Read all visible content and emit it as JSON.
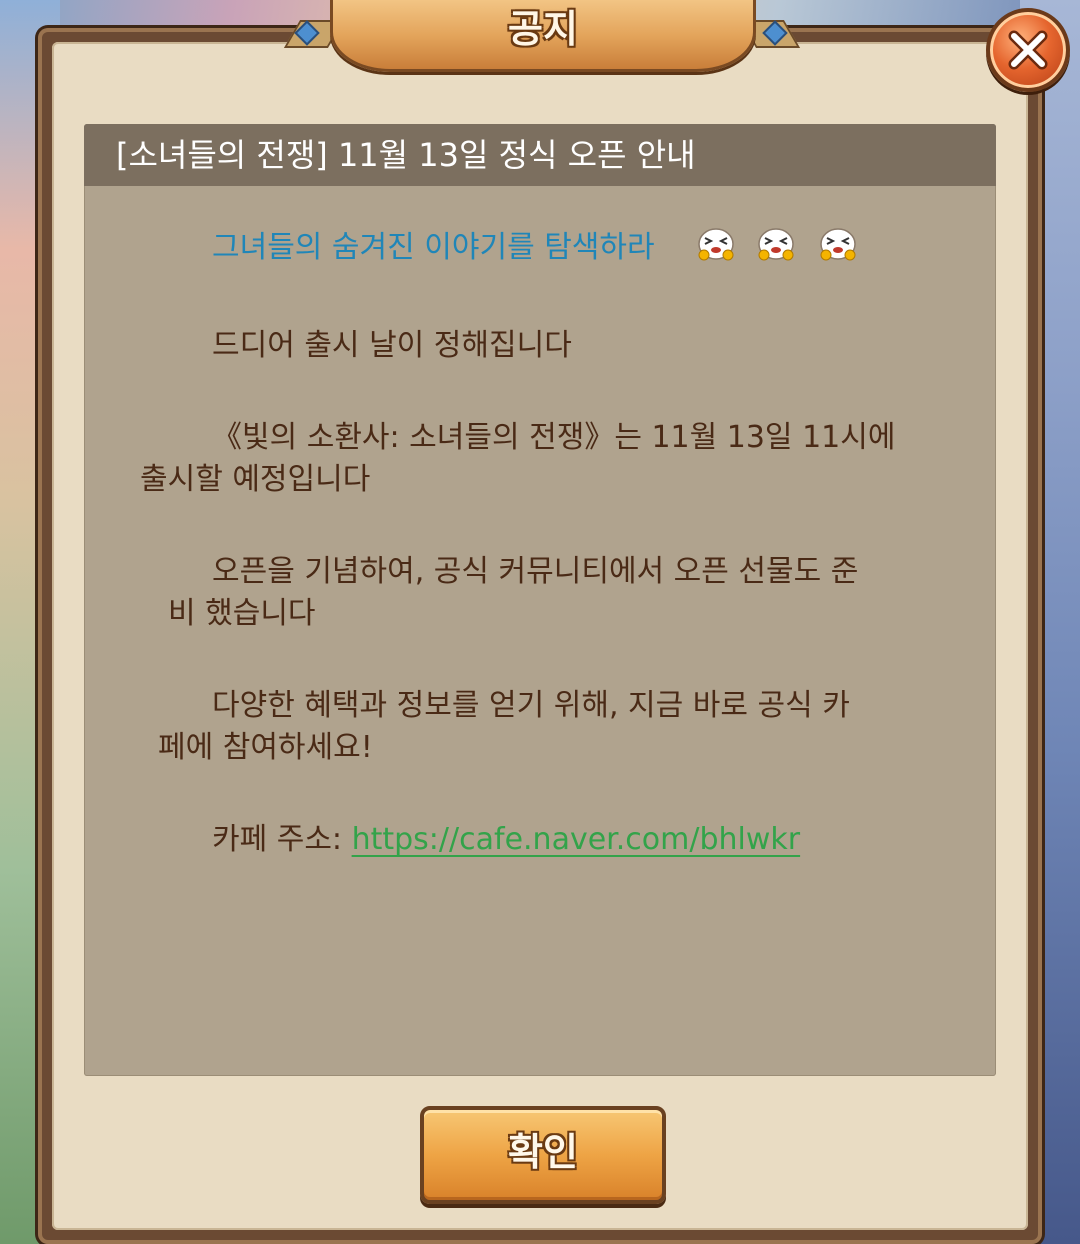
{
  "dialog": {
    "title": "공지",
    "close_icon": "close-icon",
    "confirm_label": "확인"
  },
  "notice": {
    "heading": "[소녀들의 전쟁] 11월 13일 정식 오픈 안내",
    "line1": "그녀들의 숨겨진 이야기를 탐색하라",
    "line1_emoji_count": 3,
    "line2": "드디어 출시 날이 정해집니다",
    "line3a": "《빛의 소환사: 소녀들의 전쟁》는 11월 13일 11시에",
    "line3b": "출시할 예정입니다",
    "line4a": "오픈을 기념하여, 공식 커뮤니티에서  오픈 선물도 준",
    "line4b": "비 했습니다",
    "line5a": "다양한 혜택과 정보를 얻기 위해, 지금 바로 공식 카",
    "line5b": "페에 참여하세요!",
    "cafe_label": "카페 주소: ",
    "cafe_url": "https://cafe.naver.com/bhlwkr"
  },
  "colors": {
    "frame": "#6b4a33",
    "panel": "#b0a38e",
    "header": "#7c6f5f",
    "teal_text": "#2086b8",
    "link": "#33a34a",
    "body_text": "#4a2a16"
  }
}
